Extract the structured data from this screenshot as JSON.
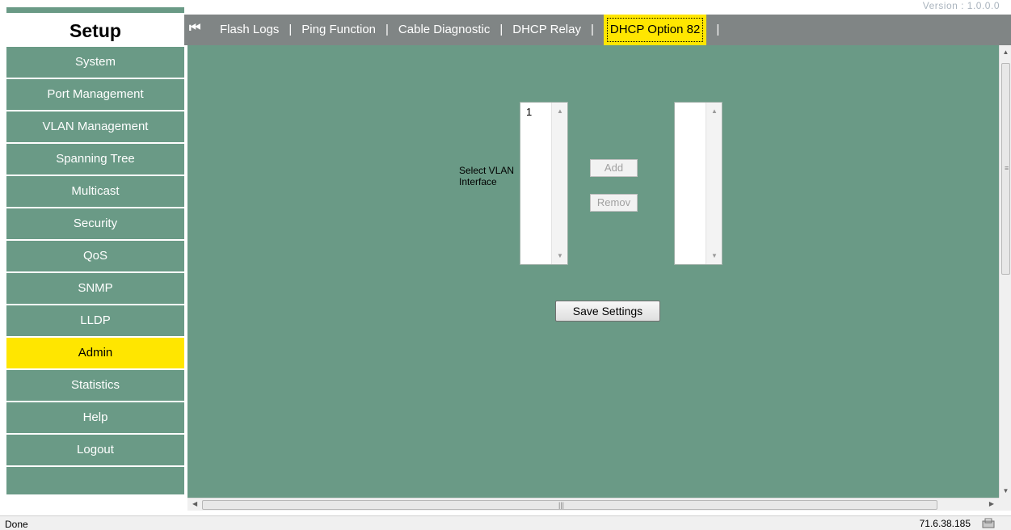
{
  "header": {
    "version_text": "Version : 1.0.0.0"
  },
  "sidebar": {
    "title": "Setup",
    "items": [
      {
        "label": "System"
      },
      {
        "label": "Port Management"
      },
      {
        "label": "VLAN Management"
      },
      {
        "label": "Spanning Tree"
      },
      {
        "label": "Multicast"
      },
      {
        "label": "Security"
      },
      {
        "label": "QoS"
      },
      {
        "label": "SNMP"
      },
      {
        "label": "LLDP"
      },
      {
        "label": "Admin"
      },
      {
        "label": "Statistics"
      },
      {
        "label": "Help"
      },
      {
        "label": "Logout"
      }
    ],
    "active_item": "Admin"
  },
  "tabs": {
    "first_icon": "⏮",
    "items": [
      {
        "label": "Flash Logs"
      },
      {
        "label": "Ping Function"
      },
      {
        "label": "Cable Diagnostic"
      },
      {
        "label": "DHCP Relay"
      },
      {
        "label": "DHCP Option 82"
      }
    ],
    "separator": "|",
    "active_tab": "DHCP Option 82"
  },
  "form": {
    "select_label": "Select VLAN Interface",
    "left_list": {
      "options": [
        "1"
      ]
    },
    "right_list": {
      "options": []
    },
    "add_label": "Add",
    "remove_label": "Remov",
    "save_label": "Save Settings"
  },
  "statusbar": {
    "status": "Done",
    "ip": "71.6.38.185"
  },
  "colors": {
    "accent": "#ffe600",
    "panel": "#6a9a86",
    "tabbar": "#808585"
  }
}
